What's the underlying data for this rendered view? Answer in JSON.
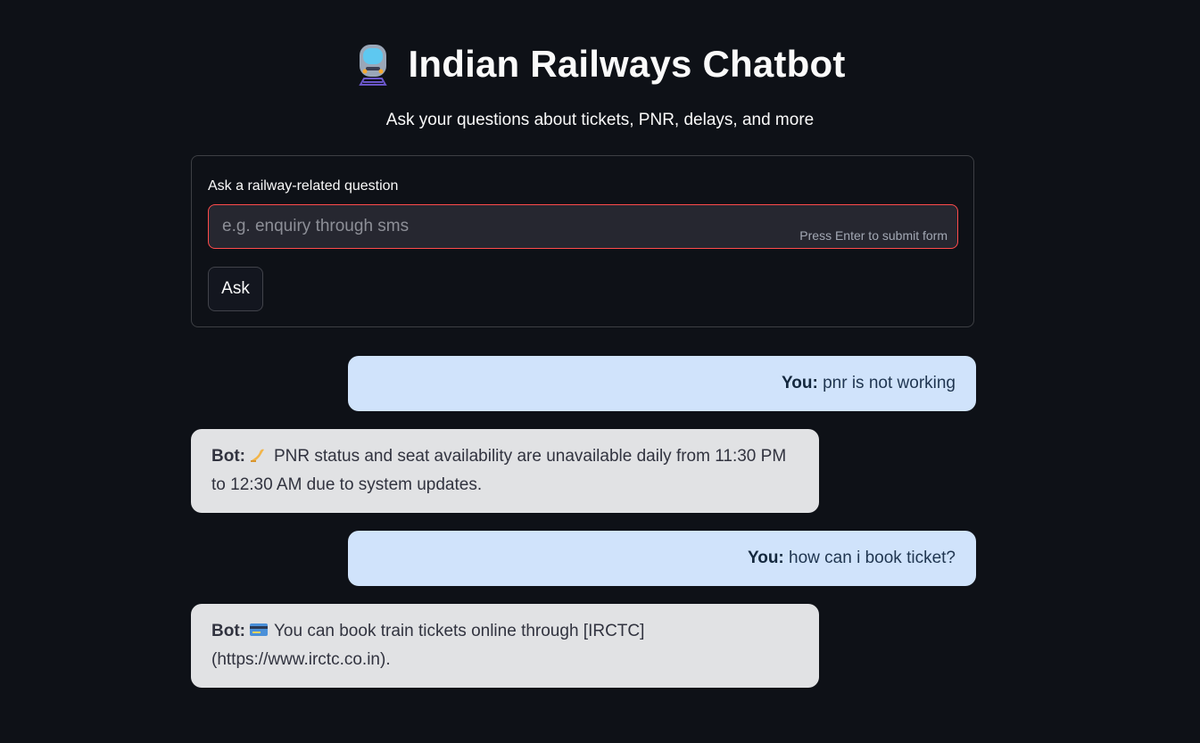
{
  "header": {
    "title": "Indian Railways Chatbot",
    "title_icon": "train-icon",
    "subtitle": "Ask your questions about tickets, PNR, delays, and more"
  },
  "form": {
    "label": "Ask a railway-related question",
    "input_value": "",
    "input_placeholder": "e.g. enquiry through sms",
    "hint": "Press Enter to submit form",
    "submit_label": "Ask",
    "input_border_color": "#ff4b4b"
  },
  "messages": [
    {
      "role": "user",
      "speaker": "You:",
      "text": "pnr is not working"
    },
    {
      "role": "bot",
      "speaker": "Bot:",
      "icon": "pray-hands-icon",
      "text": "PNR status and seat availability are unavailable daily from 11:30 PM to 12:30 AM due to system updates."
    },
    {
      "role": "user",
      "speaker": "You:",
      "text": "how can i book ticket?"
    },
    {
      "role": "bot",
      "speaker": "Bot:",
      "icon": "credit-card-icon",
      "text": "You can book train tickets online through [IRCTC](https://www.irctc.co.in)."
    }
  ],
  "colors": {
    "background": "#0e1117",
    "user_bubble": "#d0e3fb",
    "bot_bubble": "#e1e2e4"
  }
}
